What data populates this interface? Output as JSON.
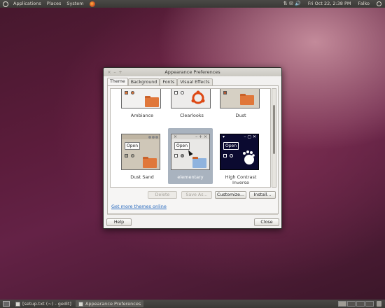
{
  "top_panel": {
    "menus": [
      "Applications",
      "Places",
      "System"
    ],
    "tray_glyphs": "⇅  ✉  🔊",
    "clock": "Fri Oct 22,  2:38 PM",
    "user": "Falko"
  },
  "window": {
    "title": "Appearance Preferences",
    "wm_buttons": [
      "×",
      "–",
      "+"
    ],
    "tabs": [
      "Theme",
      "Background",
      "Fonts",
      "Visual Effects"
    ],
    "active_tab": "Theme",
    "themes": [
      {
        "name": "Ambiance"
      },
      {
        "name": "Clearlooks"
      },
      {
        "name": "Dust"
      },
      {
        "name": "Dust Sand",
        "open_label": "Open"
      },
      {
        "name": "elementary",
        "open_label": "Open",
        "selected": true
      },
      {
        "name": "High Contrast Inverse",
        "name_line1": "High Contrast",
        "name_line2": "Inverse",
        "open_label": "Open"
      }
    ],
    "buttons": {
      "delete": "Delete",
      "save_as": "Save As...",
      "customize": "Customize...",
      "install": "Install..."
    },
    "link": "Get more themes online",
    "help": "Help",
    "close": "Close"
  },
  "taskbar": {
    "tasks": [
      {
        "label": "[setup.txt (~) - gedit]",
        "active": false
      },
      {
        "label": "Appearance Preferences",
        "active": true
      }
    ]
  },
  "colors": {
    "selection": "#a9b3bf",
    "folder": "#e0773a",
    "link": "#2a6bbf"
  }
}
